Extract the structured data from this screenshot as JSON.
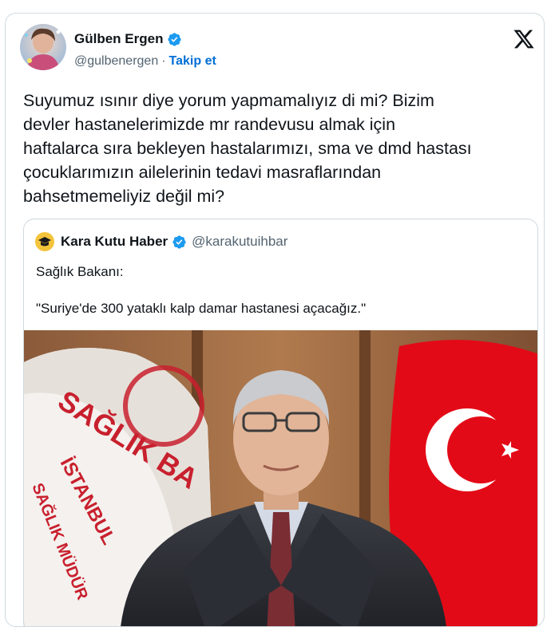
{
  "author": {
    "display_name": "Gülben Ergen",
    "handle": "@gulbenergen",
    "separator": "·",
    "follow_label": "Takip et"
  },
  "tweet": {
    "text": "Suyumuz ısınır diye yorum yapmamalıyız di mi? Bizim\ndevler hastanelerimizde mr randevusu almak için\nhaftalarca sıra bekleyen hastalarımızı, sma ve dmd hastası\nçocuklarımızın ailelerinin tedavi masraflarından\nbahsetmemeliyiz değil mi?"
  },
  "quote": {
    "display_name": "Kara Kutu Haber",
    "handle": "@karakutuihbar",
    "line1": "Sağlık Bakanı:",
    "line2": "\"Suriye'de 300 yataklı kalp damar hastanesi açacağız.\"",
    "image_banner_text": "SAĞLIK BA",
    "image_banner_sub1": "İSTANBUL",
    "image_banner_sub2": "SAĞLIK MÜDÜR"
  },
  "colors": {
    "accent": "#006fd6",
    "verified": "#1d9bf0",
    "flag_red": "#e30a17",
    "banner_red": "#c8202e"
  },
  "icons": {
    "brand": "x-logo-icon",
    "verified": "verified-badge-icon"
  }
}
